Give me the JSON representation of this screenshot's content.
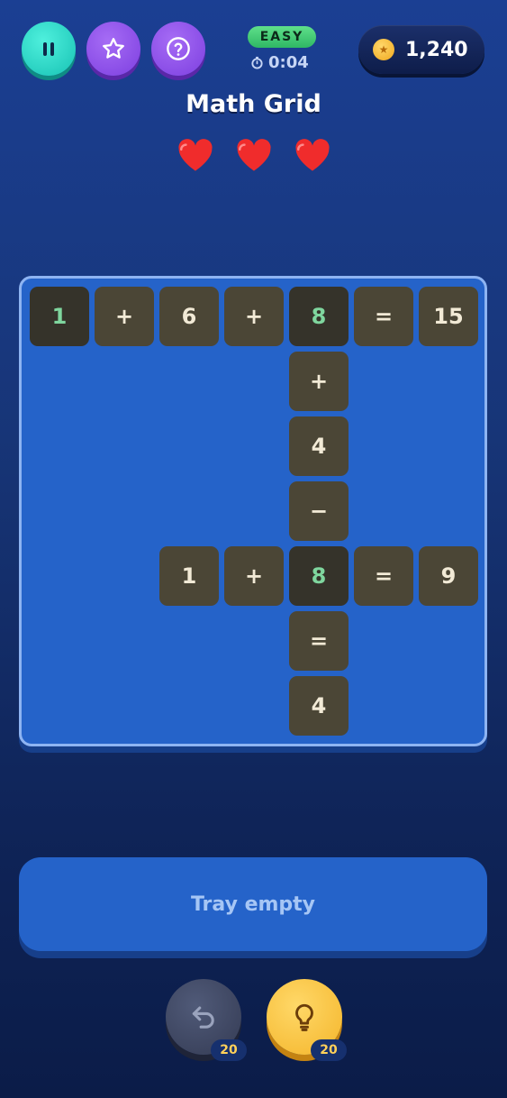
{
  "header": {
    "difficulty": "EASY",
    "timer": "0:04",
    "coins": "1,240"
  },
  "title": "Math Grid",
  "lives": 3,
  "grid": {
    "cells": [
      {
        "row": 0,
        "col": 0,
        "value": "1",
        "given": true
      },
      {
        "row": 0,
        "col": 1,
        "value": "+",
        "given": false
      },
      {
        "row": 0,
        "col": 2,
        "value": "6",
        "given": false
      },
      {
        "row": 0,
        "col": 3,
        "value": "+",
        "given": false
      },
      {
        "row": 0,
        "col": 4,
        "value": "8",
        "given": true
      },
      {
        "row": 0,
        "col": 5,
        "value": "=",
        "given": false
      },
      {
        "row": 0,
        "col": 6,
        "value": "15",
        "given": false
      },
      {
        "row": 1,
        "col": 4,
        "value": "+",
        "given": false
      },
      {
        "row": 2,
        "col": 4,
        "value": "4",
        "given": false
      },
      {
        "row": 3,
        "col": 4,
        "value": "−",
        "given": false
      },
      {
        "row": 4,
        "col": 2,
        "value": "1",
        "given": false
      },
      {
        "row": 4,
        "col": 3,
        "value": "+",
        "given": false
      },
      {
        "row": 4,
        "col": 4,
        "value": "8",
        "given": true
      },
      {
        "row": 4,
        "col": 5,
        "value": "=",
        "given": false
      },
      {
        "row": 4,
        "col": 6,
        "value": "9",
        "given": false
      },
      {
        "row": 5,
        "col": 4,
        "value": "=",
        "given": false
      },
      {
        "row": 6,
        "col": 4,
        "value": "4",
        "given": false
      }
    ]
  },
  "tray": {
    "label": "Tray empty"
  },
  "tools": {
    "undo_count": "20",
    "hint_count": "20"
  },
  "colors": {
    "background": "#173577",
    "board": "#2563c9",
    "tile": "#4b4636",
    "tile_given": "#35332a",
    "given_text": "#7fd69e",
    "heart": "#f02c2c",
    "difficulty_badge": "#3fc873"
  },
  "icons": {
    "pause": "pause-icon",
    "star": "star-icon",
    "help": "question-icon",
    "timer": "stopwatch-icon",
    "coin": "coin-icon",
    "life": "heart-icon",
    "undo": "undo-icon",
    "hint": "lightbulb-icon"
  }
}
